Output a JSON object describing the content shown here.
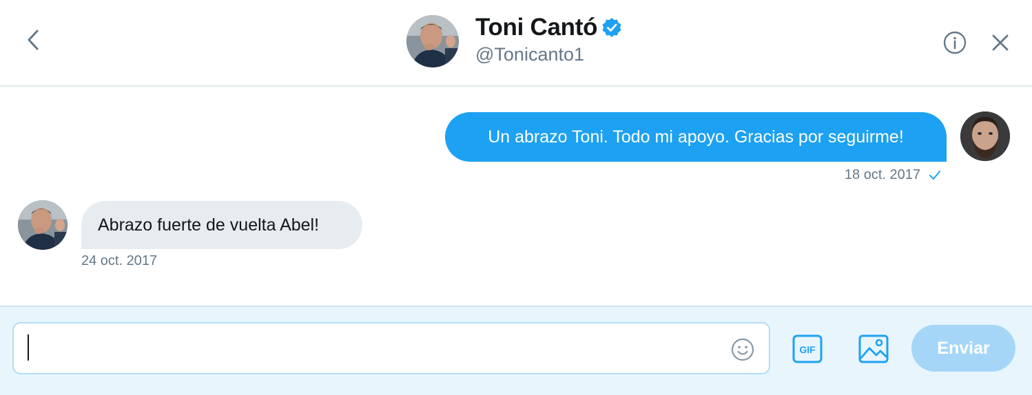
{
  "header": {
    "name": "Toni Cantó",
    "handle": "@Tonicanto1"
  },
  "messages": [
    {
      "direction": "sent",
      "text": "Un abrazo Toni. Todo mi apoyo. Gracias por seguirme!",
      "date": "18 oct. 2017",
      "read": true
    },
    {
      "direction": "received",
      "text": "Abrazo fuerte de vuelta Abel!",
      "date": "24 oct. 2017"
    }
  ],
  "composer": {
    "value": "",
    "send_label": "Enviar",
    "gif_label": "GIF"
  },
  "colors": {
    "accent": "#1da1f2",
    "received_bubble": "#e6ecf0",
    "composer_bg": "#e8f5fd",
    "send_disabled": "#a5d6f7"
  },
  "icons": [
    "back-arrow-icon",
    "verified-badge-icon",
    "info-icon",
    "close-icon",
    "read-check-icon",
    "emoji-icon",
    "gif-icon",
    "image-icon"
  ]
}
